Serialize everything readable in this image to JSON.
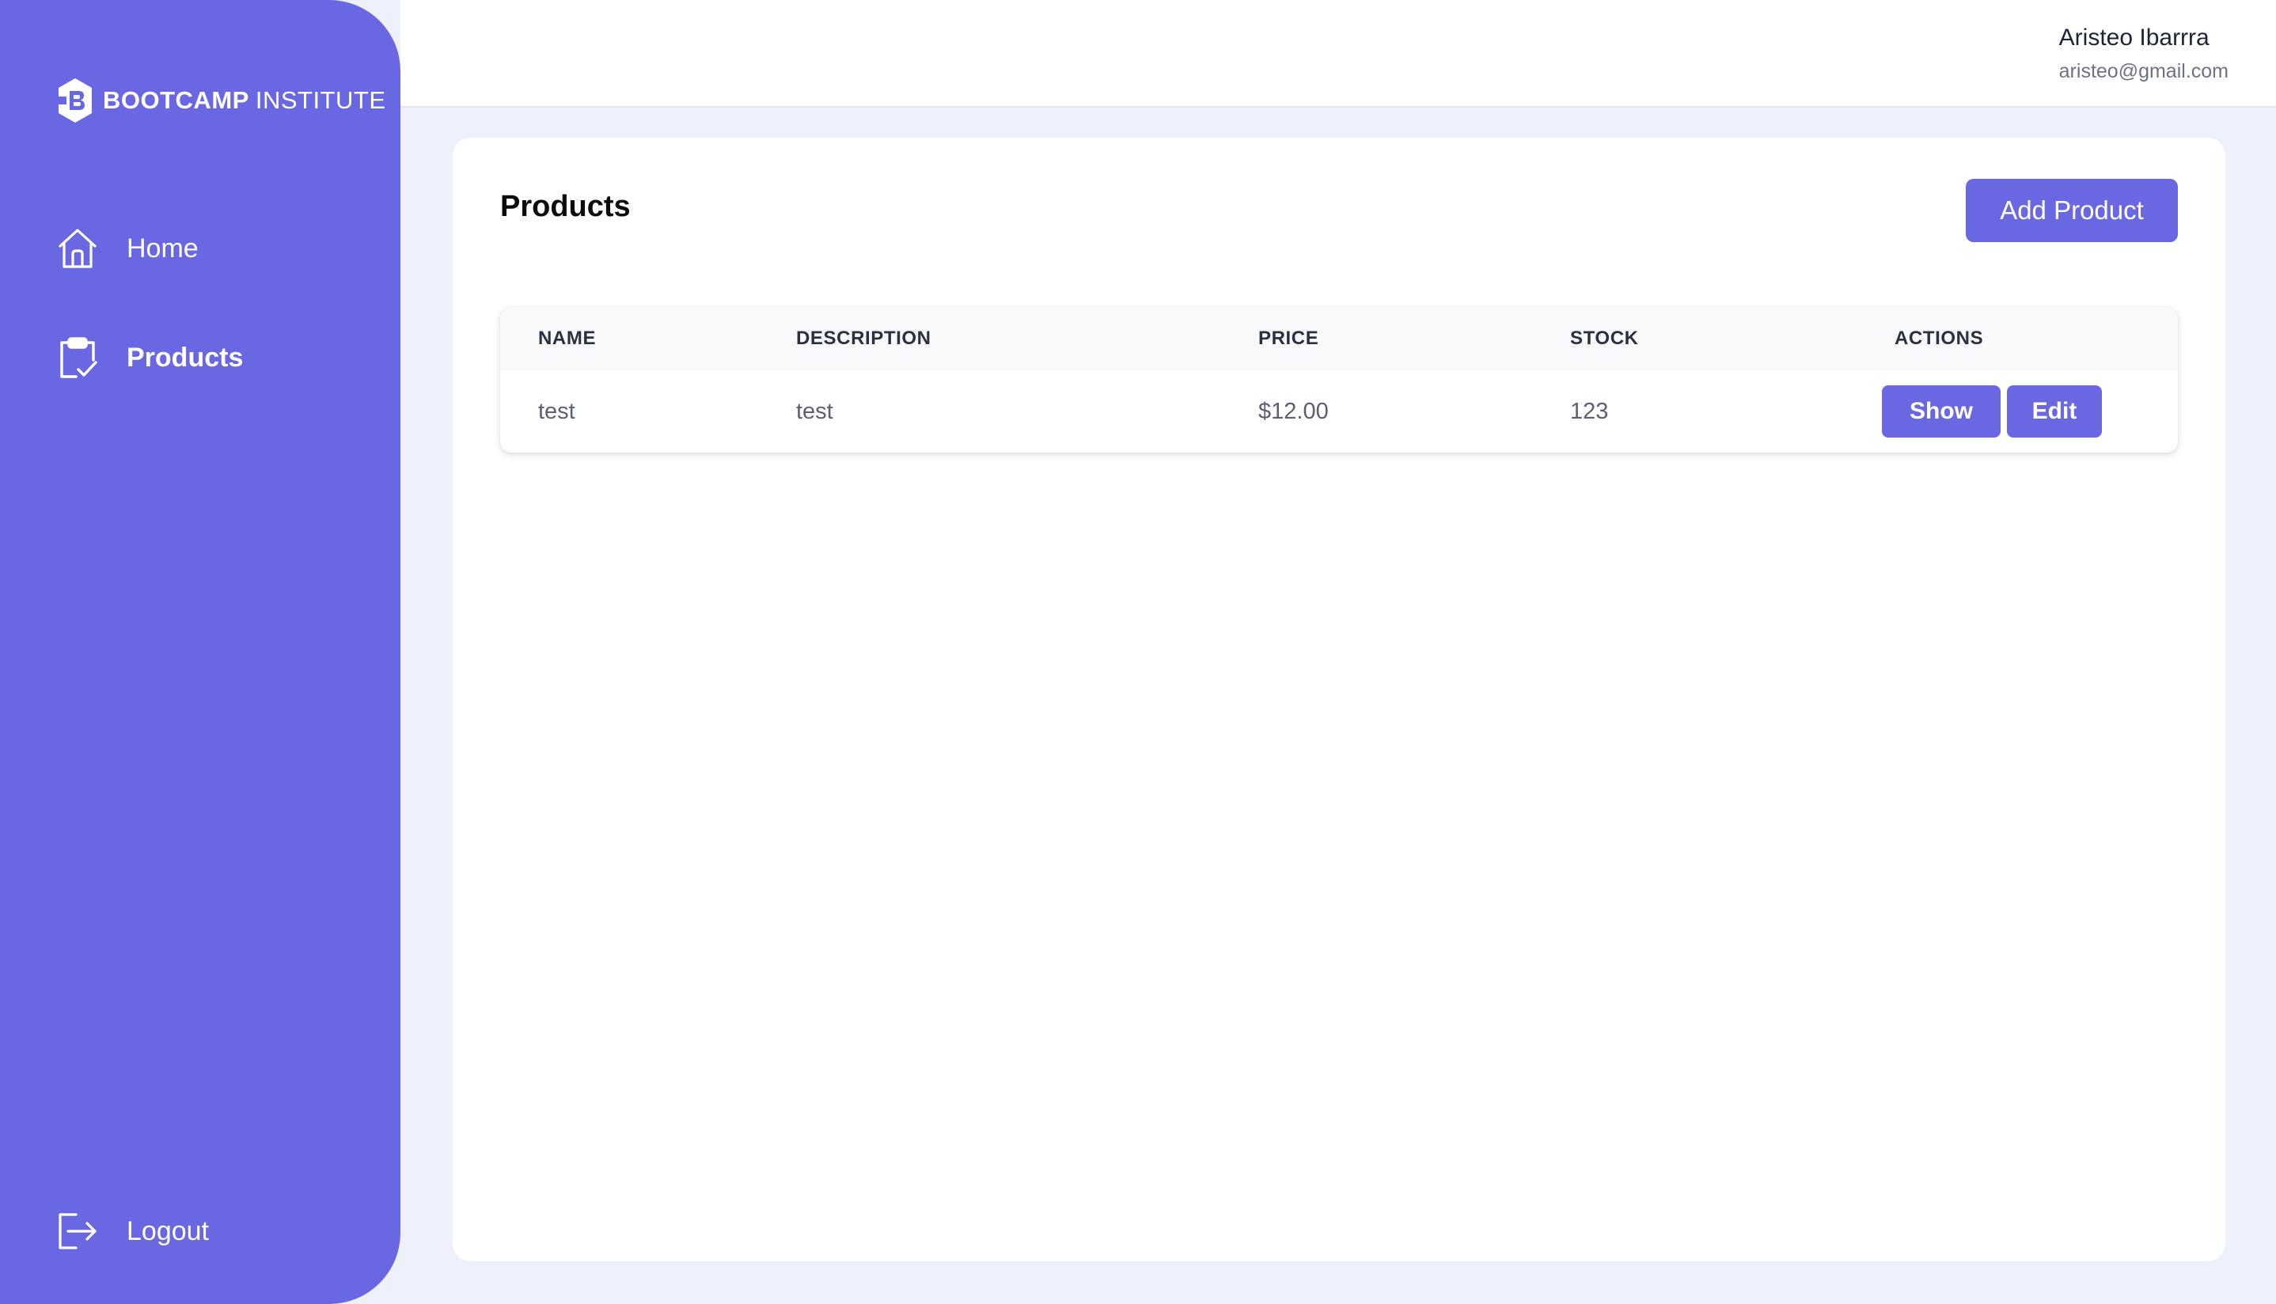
{
  "brand": {
    "name_bold": "BOOTCAMP",
    "name_light": "INSTITUTE",
    "logo_icon": "bootcamp-logo-icon",
    "accent_color": "#6a67e3"
  },
  "sidebar": {
    "items": [
      {
        "label": "Home",
        "icon": "home-icon",
        "active": false
      },
      {
        "label": "Products",
        "icon": "clipboard-check-icon",
        "active": true
      }
    ],
    "logout": {
      "label": "Logout",
      "icon": "logout-icon"
    }
  },
  "header": {
    "user_name": "Aristeo Ibarrra",
    "user_email": "aristeo@gmail.com"
  },
  "main": {
    "title": "Products",
    "add_button_label": "Add Product",
    "table": {
      "columns": [
        "NAME",
        "DESCRIPTION",
        "PRICE",
        "STOCK",
        "ACTIONS"
      ],
      "rows": [
        {
          "name": "test",
          "description": "test",
          "price": "$12.00",
          "stock": "123",
          "actions": [
            "Show",
            "Edit"
          ]
        }
      ]
    }
  }
}
